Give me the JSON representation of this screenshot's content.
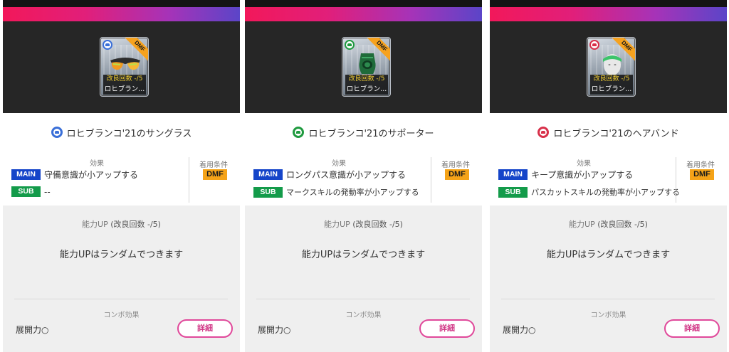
{
  "panels": [
    {
      "item_name": "ロヒブランコ'21のサングラス",
      "card_name": "ロヒブラン...",
      "card_count": "改良回数 -/5",
      "position_badge": "DMF",
      "icon": "sunglasses-icon",
      "accent": "#3a6fd8",
      "effect_label": "効果",
      "main_tag": "MAIN",
      "main_text": "守備意識が小アップする",
      "sub_tag": "SUB",
      "sub_text": "--",
      "cond_label": "着用条件",
      "cond_value": "DMF",
      "ability_label": "能力UP",
      "ability_count": "(改良回数 -/5)",
      "ability_msg": "能力UPはランダムでつきます",
      "combo_label": "コンボ効果",
      "combo_value": "展開力○",
      "detail_label": "詳細"
    },
    {
      "item_name": "ロヒブランコ'21のサポーター",
      "card_name": "ロヒブラン...",
      "card_count": "改良回数 -/5",
      "position_badge": "DMF",
      "icon": "knee-support-icon",
      "accent": "#1f9a3f",
      "effect_label": "効果",
      "main_tag": "MAIN",
      "main_text": "ロングパス意識が小アップする",
      "sub_tag": "SUB",
      "sub_text": "マークスキルの発動率が小アップする",
      "cond_label": "着用条件",
      "cond_value": "DMF",
      "ability_label": "能力UP",
      "ability_count": "(改良回数 -/5)",
      "ability_msg": "能力UPはランダムでつきます",
      "combo_label": "コンボ効果",
      "combo_value": "展開力○",
      "detail_label": "詳細"
    },
    {
      "item_name": "ロヒブランコ'21のヘアバンド",
      "card_name": "ロヒブラン...",
      "card_count": "改良回数 -/5",
      "position_badge": "DMF",
      "icon": "hairband-icon",
      "accent": "#d8304a",
      "effect_label": "効果",
      "main_tag": "MAIN",
      "main_text": "キープ意識が小アップする",
      "sub_tag": "SUB",
      "sub_text": "パスカットスキルの発動率が小アップする",
      "cond_label": "着用条件",
      "cond_value": "DMF",
      "ability_label": "能力UP",
      "ability_count": "(改良回数 -/5)",
      "ability_msg": "能力UPはランダムでつきます",
      "combo_label": "コンボ効果",
      "combo_value": "展開力○",
      "detail_label": "詳細"
    }
  ]
}
